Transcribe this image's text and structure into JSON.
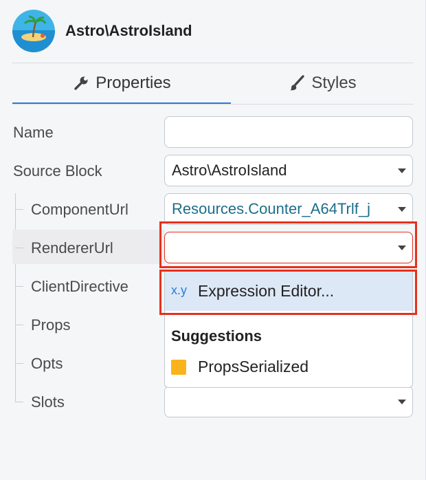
{
  "header": {
    "title": "Astro\\AstroIsland",
    "logo_icon": "island-logo"
  },
  "tabs": [
    {
      "label": "Properties",
      "icon": "wrench-icon",
      "active": true
    },
    {
      "label": "Styles",
      "icon": "brush-icon",
      "active": false
    }
  ],
  "fields": {
    "name": {
      "label": "Name",
      "value": ""
    },
    "source_block": {
      "label": "Source Block",
      "value": "Astro\\AstroIsland"
    },
    "component_url": {
      "label": "ComponentUrl",
      "value_prefix": "Resources.",
      "value_rest": "Counter_A64Trlf_j"
    },
    "renderer_url": {
      "label": "RendererUrl",
      "value": ""
    },
    "client_directive": {
      "label": "ClientDirective"
    },
    "props": {
      "label": "Props"
    },
    "opts": {
      "label": "Opts"
    },
    "slots": {
      "label": "Slots",
      "value": ""
    }
  },
  "dropdown": {
    "expression_badge": "x.y",
    "expression_label": "Expression Editor...",
    "suggestions_heading": "Suggestions",
    "suggestions": [
      {
        "label": "PropsSerialized",
        "color": "#fbb31b"
      }
    ]
  },
  "colors": {
    "accent": "#2a7bd8",
    "highlight": "#e5301c",
    "link": "#1b6e8a"
  }
}
